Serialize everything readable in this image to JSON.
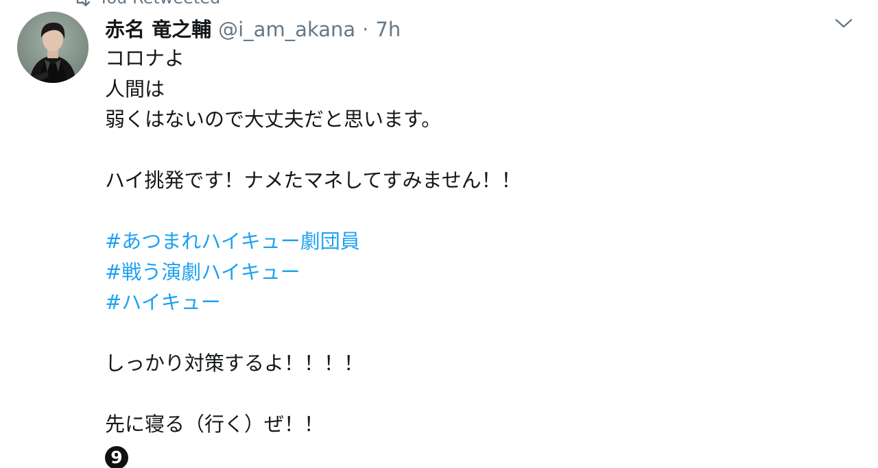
{
  "retweet_context": {
    "icon": "retweet-icon",
    "text": "You Retweeted"
  },
  "tweet": {
    "avatar_icon": "avatar-photo",
    "display_name": "赤名 竜之輔",
    "handle": "@i_am_akana",
    "separator": "·",
    "timestamp": "7h",
    "menu_icon": "chevron-down-icon",
    "lines": {
      "l1": "コロナよ",
      "l2": "人間は",
      "l3": "弱くはないので大丈夫だと思います。",
      "l4": "ハイ挑発です！ナメたマネしてすみません！！",
      "l5": "しっかり対策するよ！！！！",
      "l6": "先に寝る（行く）ぜ！！"
    },
    "hashtags": {
      "h1": "#あつまれハイキュー劇団員",
      "h2": "#戦う演劇ハイキュー",
      "h3": "#ハイキュー"
    },
    "emoji": "9"
  },
  "colors": {
    "text": "#14171a",
    "secondary": "#657786",
    "link": "#1da1f2",
    "background": "#ffffff"
  }
}
